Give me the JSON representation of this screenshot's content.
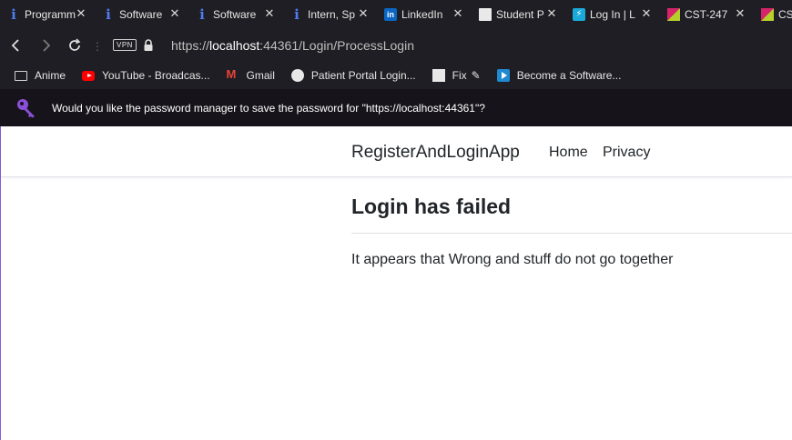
{
  "tabs": [
    {
      "title": "Programm",
      "icon": "info-icon"
    },
    {
      "title": "Software",
      "icon": "info-icon"
    },
    {
      "title": "Software",
      "icon": "info-icon"
    },
    {
      "title": "Intern, Sp",
      "icon": "info-icon"
    },
    {
      "title": "LinkedIn",
      "icon": "linkedin-icon"
    },
    {
      "title": "Student P",
      "icon": "document-icon"
    },
    {
      "title": "Log In | L",
      "icon": "bolt-icon"
    },
    {
      "title": "CST-247",
      "icon": "cst-icon"
    },
    {
      "title": "CS",
      "icon": "cst-icon"
    }
  ],
  "toolbar": {
    "vpn_label": "VPN",
    "url_scheme": "https://",
    "url_host": "localhost",
    "url_rest": ":44361/Login/ProcessLogin"
  },
  "bookmarks": [
    {
      "label": "Anime",
      "icon": "folder-icon"
    },
    {
      "label": "YouTube - Broadcas...",
      "icon": "youtube-icon"
    },
    {
      "label": "Gmail",
      "icon": "gmail-icon"
    },
    {
      "label": "Patient Portal Login...",
      "icon": "patient-portal-icon"
    },
    {
      "label": "Fix",
      "icon": "file-icon"
    },
    {
      "label": "Become a Software...",
      "icon": "play-icon"
    }
  ],
  "password_bar": {
    "message": "Would you like the password manager to save the password for \"https://localhost:44361\"?"
  },
  "page": {
    "brand": "RegisterAndLoginApp",
    "nav": [
      "Home",
      "Privacy"
    ],
    "title": "Login has failed",
    "message": "It appears that Wrong and stuff do not go together"
  },
  "colors": {
    "chrome_bg": "#1f1e24",
    "password_bar_bg": "#16141a",
    "key_icon": "#8b4fd8",
    "text_dark": "#212529"
  }
}
